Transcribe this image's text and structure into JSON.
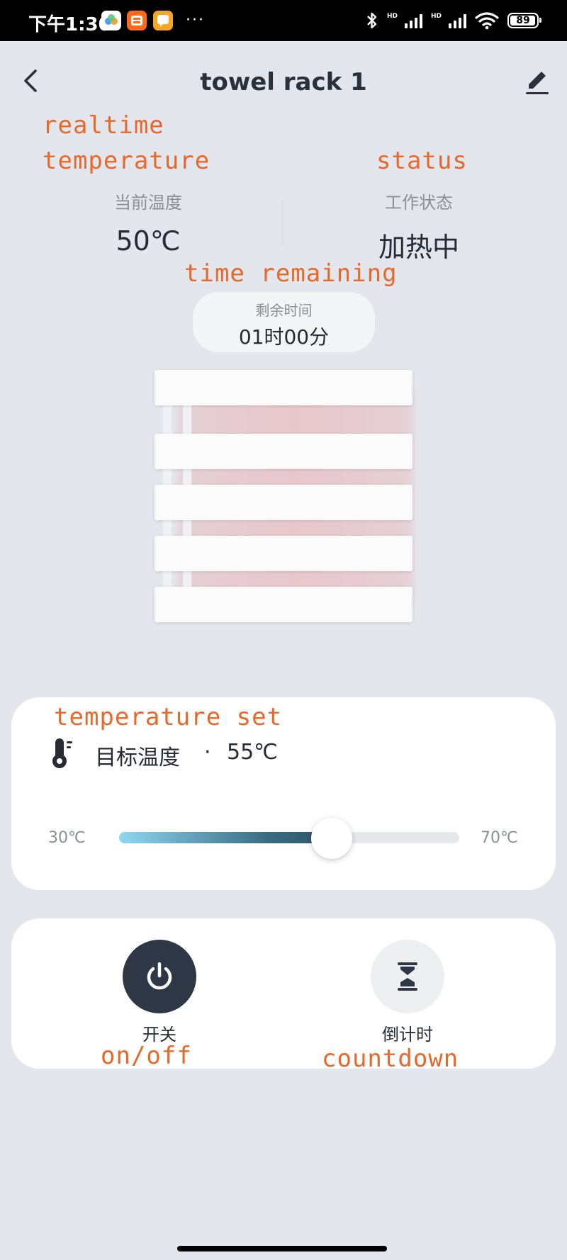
{
  "status_bar": {
    "time": "下午1:30",
    "app_icons": [
      "cloud-app-icon",
      "taobao-icon",
      "message-app-icon"
    ],
    "more": "···",
    "battery": "89",
    "network_labels": [
      "HD",
      "HD"
    ]
  },
  "header": {
    "title": "towel rack 1"
  },
  "annotations": {
    "realtime_temperature": "realtime\ntemperature",
    "status": "status",
    "time_remaining": "time remaining",
    "temperature_set": "temperature set",
    "on_off": "on/off",
    "countdown": "countdown"
  },
  "stats": {
    "current_temp_label": "当前温度",
    "current_temp_value": "50℃",
    "status_label": "工作状态",
    "status_value": "加热中"
  },
  "timer": {
    "label": "剩余时间",
    "value": "01时00分"
  },
  "temperature_setting": {
    "label": "目标温度",
    "separator": "·",
    "value": "55℃",
    "min_label": "30℃",
    "max_label": "70℃",
    "min": 30,
    "max": 70,
    "current": 55
  },
  "controls": {
    "power_label": "开关",
    "countdown_label": "倒计时"
  },
  "colors": {
    "accent_annotation": "#e8682a",
    "power_button": "#2d3746",
    "slider_start": "#8fd6f2",
    "slider_end": "#2d5466"
  }
}
